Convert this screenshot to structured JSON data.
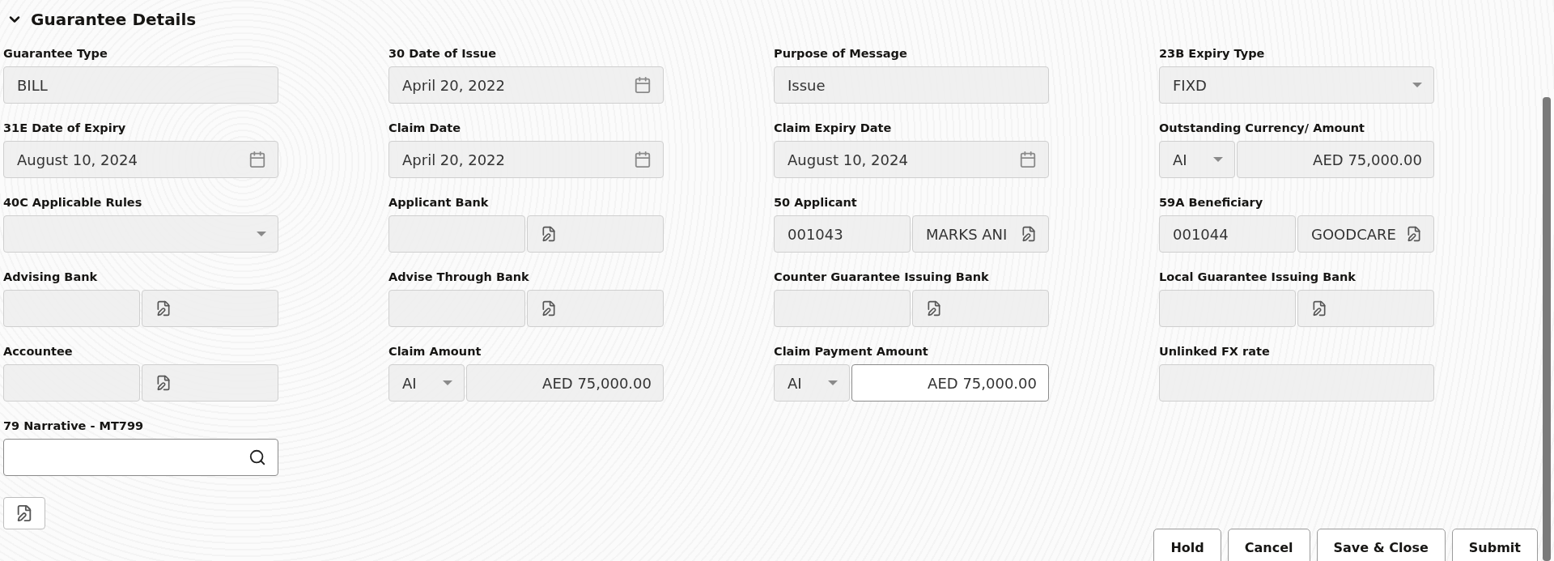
{
  "section": {
    "title": "Guarantee Details",
    "expanded": true
  },
  "fields": [
    {
      "label": "Guarantee Type",
      "kind": "text",
      "value": "BILL"
    },
    {
      "label": "30 Date of Issue",
      "kind": "date",
      "value": "April 20, 2022"
    },
    {
      "label": "Purpose of Message",
      "kind": "text",
      "value": "Issue"
    },
    {
      "label": "23B Expiry Type",
      "kind": "select",
      "value": "FIXD"
    },
    {
      "label": "31E Date of Expiry",
      "kind": "date",
      "value": "August 10, 2024"
    },
    {
      "label": "Claim Date",
      "kind": "date",
      "value": "April 20, 2022"
    },
    {
      "label": "Claim Expiry Date",
      "kind": "date",
      "value": "August 10, 2024"
    },
    {
      "label": "Outstanding Currency/ Amount",
      "kind": "amount",
      "currency": "AI",
      "value": "AED 75,000.00",
      "editable": false
    },
    {
      "label": "40C Applicable Rules",
      "kind": "select"
    },
    {
      "label": "Applicant Bank",
      "kind": "lookup"
    },
    {
      "label": "50 Applicant",
      "kind": "lookup",
      "code": "001043",
      "value": "MARKS ANI"
    },
    {
      "label": "59A Beneficiary",
      "kind": "lookup",
      "code": "001044",
      "value": "GOODCARE"
    },
    {
      "label": "Advising Bank",
      "kind": "lookup"
    },
    {
      "label": "Advise Through Bank",
      "kind": "lookup"
    },
    {
      "label": "Counter Guarantee Issuing Bank",
      "kind": "lookup"
    },
    {
      "label": "Local Guarantee Issuing Bank",
      "kind": "lookup"
    },
    {
      "label": "Accountee",
      "kind": "lookup"
    },
    {
      "label": "Claim Amount",
      "kind": "amount",
      "currency": "AI",
      "value": "AED 75,000.00",
      "editable": false
    },
    {
      "label": "Claim Payment Amount",
      "kind": "amount",
      "currency": "AI",
      "value": "AED 75,000.00",
      "editable": true
    },
    {
      "label": "Unlinked FX rate",
      "kind": "text"
    },
    {
      "label": "79 Narrative - MT799",
      "kind": "search"
    }
  ],
  "buttons": [
    "Hold",
    "Cancel",
    "Save & Close",
    "Submit"
  ]
}
